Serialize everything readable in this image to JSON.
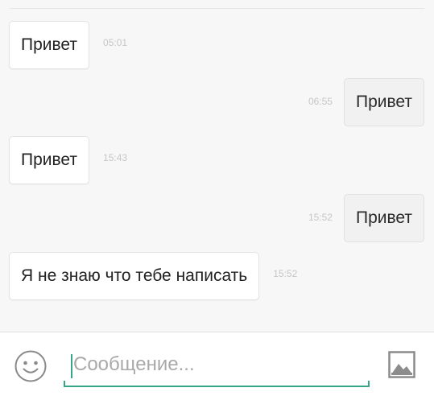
{
  "messages": [
    {
      "direction": "in",
      "text": "Привет",
      "time": "05:01"
    },
    {
      "direction": "out",
      "text": "Привет",
      "time": "06:55"
    },
    {
      "direction": "in",
      "text": "Привет",
      "time": "15:43"
    },
    {
      "direction": "out",
      "text": "Привет",
      "time": "15:52"
    },
    {
      "direction": "in",
      "text": "Я не знаю что тебе написать",
      "time": "15:52"
    }
  ],
  "composer": {
    "placeholder": "Сообщение...",
    "emoji_icon": "smiley-face-icon",
    "attach_icon": "image-icon",
    "accent_color": "#35a688"
  },
  "colors": {
    "background": "#f7f7f7",
    "incoming_bubble": "#ffffff",
    "outgoing_bubble": "#f1f1f1"
  }
}
